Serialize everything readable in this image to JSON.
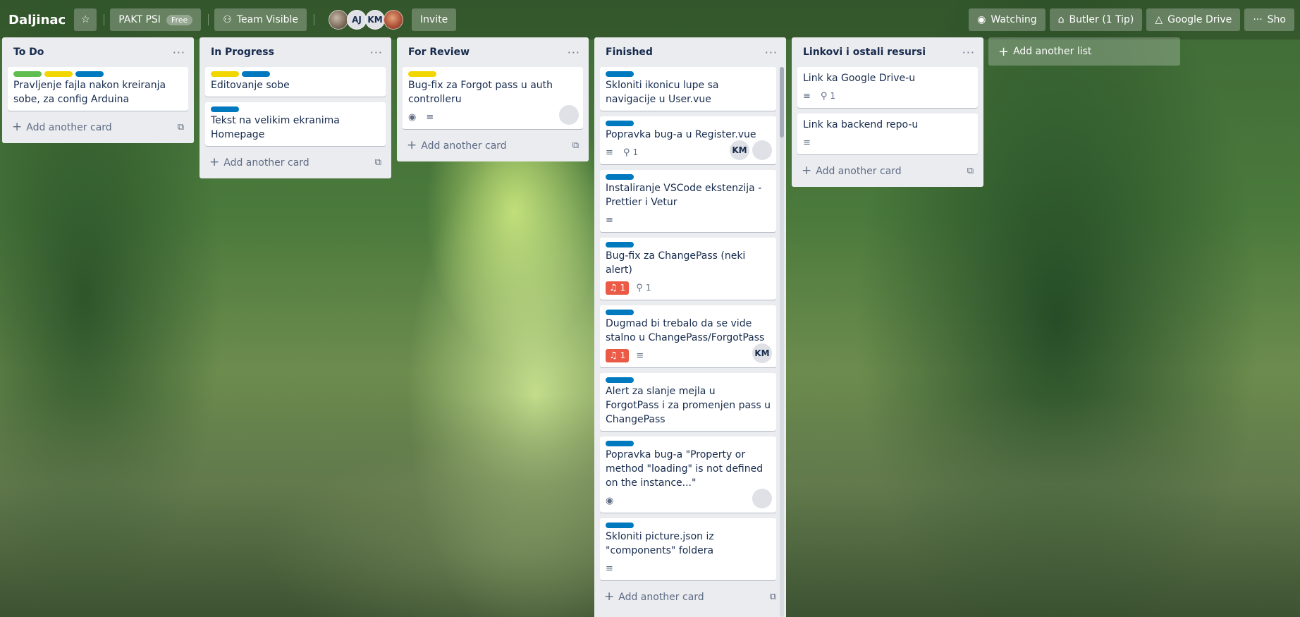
{
  "header": {
    "board_title": "Daljinac",
    "workspace_label": "PAKT PSI",
    "workspace_badge": "Free",
    "visibility_label": "Team Visible",
    "member_initials_1": "AJ",
    "member_initials_2": "KM",
    "invite_label": "Invite",
    "watching_label": "Watching",
    "butler_label": "Butler (1 Tip)",
    "google_drive_label": "Google Drive",
    "show_menu_label": "Sho"
  },
  "colors": {
    "label_green": "#61bd4f",
    "label_yellow": "#f2d600",
    "label_blue": "#0079bf",
    "label_red": "#eb5a46",
    "list_bg": "#ebecf0"
  },
  "lists": [
    {
      "title": "To Do",
      "cards": [
        {
          "title": "Pravljenje fajla nakon kreiranja sobe, za config Arduina",
          "labels": [
            "green",
            "yellow",
            "blue"
          ]
        }
      ],
      "add_card": "Add another card"
    },
    {
      "title": "In Progress",
      "cards": [
        {
          "title": "Editovanje sobe",
          "labels": [
            "yellow",
            "blue"
          ]
        },
        {
          "title": "Tekst na velikim ekranima Homepage",
          "labels": [
            "blue"
          ]
        }
      ],
      "add_card": "Add another card"
    },
    {
      "title": "For Review",
      "cards": [
        {
          "title": "Bug-fix za Forgot pass u auth controlleru",
          "labels": [
            "yellow"
          ]
        }
      ],
      "add_card": "Add another card"
    },
    {
      "title": "Finished",
      "cards": [
        {
          "title": "Skloniti ikonicu lupe sa navigacije u User.vue",
          "labels": [
            "blue"
          ]
        },
        {
          "title": "Popravka bug-a u Register.vue",
          "labels": [
            "blue"
          ],
          "attachments": "1",
          "member": "KM"
        },
        {
          "title": "Instaliranje VSCode ekstenzija - Prettier i Vetur",
          "labels": [
            "blue"
          ]
        },
        {
          "title": "Bug-fix za ChangePass (neki alert)",
          "labels": [
            "blue"
          ],
          "notifications": "1",
          "attachments": "1"
        },
        {
          "title": "Dugmad bi trebalo da se vide stalno u ChangePass/ForgotPass",
          "labels": [
            "blue"
          ],
          "notifications": "1",
          "member": "KM"
        },
        {
          "title": "Alert za slanje mejla u ForgotPass i za promenjen pass u ChangePass",
          "labels": [
            "blue"
          ]
        },
        {
          "title": "Popravka bug-a \"Property or method \"loading\" is not defined on the instance...\"",
          "labels": [
            "blue"
          ]
        },
        {
          "title": "Skloniti picture.json iz \"components\" foldera",
          "labels": [
            "blue"
          ]
        },
        {
          "title": "",
          "labels": [
            "yellow",
            "red"
          ]
        }
      ],
      "add_card": "Add another card"
    },
    {
      "title": "Linkovi i ostali resursi",
      "cards": [
        {
          "title": "Link ka Google Drive-u",
          "attachments": "1"
        },
        {
          "title": "Link ka backend repo-u"
        }
      ],
      "add_card": "Add another card"
    }
  ],
  "add_list": "Add another list"
}
